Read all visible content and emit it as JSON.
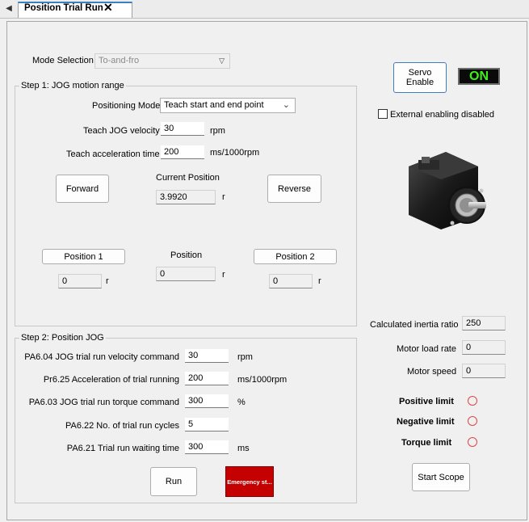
{
  "tab": {
    "title": "Position Trial Run",
    "close": "✕"
  },
  "mode": {
    "label": "Mode Selection",
    "value": "To-and-fro"
  },
  "servo": {
    "enable_label": "Servo Enable",
    "status": "ON",
    "external_label": "External enabling disabled"
  },
  "step1": {
    "title": "Step 1: JOG motion range",
    "positioning_mode_label": "Positioning Mode",
    "positioning_mode_value": "Teach start and end point",
    "jog_velocity_label": "Teach JOG velocity",
    "jog_velocity_value": "30",
    "jog_velocity_unit": "rpm",
    "accel_label": "Teach acceleration time",
    "accel_value": "200",
    "accel_unit": "ms/1000rpm",
    "forward_label": "Forward",
    "reverse_label": "Reverse",
    "current_position_label": "Current Position",
    "current_position_value": "3.9920",
    "current_position_unit": "r",
    "position1_label": "Position 1",
    "position1_value": "0",
    "position1_unit": "r",
    "position_label": "Position",
    "position_value": "0",
    "position_unit": "r",
    "position2_label": "Position 2",
    "position2_value": "0",
    "position2_unit": "r"
  },
  "step2": {
    "title": "Step 2: Position JOG",
    "rows": [
      {
        "label": "PA6.04 JOG trial run velocity command",
        "value": "30",
        "unit": "rpm"
      },
      {
        "label": "Pr6.25 Acceleration of trial running",
        "value": "200",
        "unit": "ms/1000rpm"
      },
      {
        "label": "PA6.03 JOG trial run torque command",
        "value": "300",
        "unit": "%"
      },
      {
        "label": "PA6.22 No. of trial run cycles",
        "value": "5",
        "unit": ""
      },
      {
        "label": "PA6.21 Trial run waiting time",
        "value": "300",
        "unit": "ms"
      }
    ],
    "run_label": "Run",
    "emergency_label": "Emergency st..."
  },
  "status": {
    "inertia_label": "Calculated inertia ratio",
    "inertia_value": "250",
    "load_label": "Motor load rate",
    "load_value": "0",
    "speed_label": "Motor speed",
    "speed_value": "0",
    "positive_limit": "Positive limit",
    "negative_limit": "Negative limit",
    "torque_limit": "Torque limit",
    "scope_label": "Start Scope"
  },
  "colors": {
    "accent": "#3c7fc0",
    "on_bg": "#0a0a0a",
    "on_fg": "#3ef01a",
    "emergency_bg": "#c40000",
    "led": "#e04646"
  }
}
